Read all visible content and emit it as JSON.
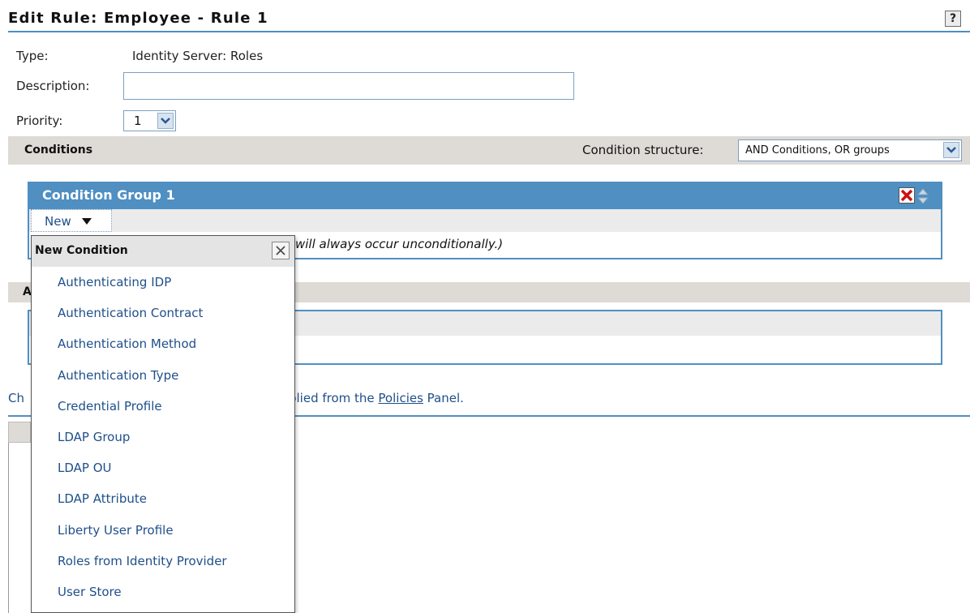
{
  "page": {
    "title": "Edit Rule: Employee - Rule 1",
    "help_label": "?"
  },
  "form": {
    "type_label": "Type:",
    "type_value": "Identity Server: Roles",
    "description_label": "Description:",
    "description_value": "",
    "priority_label": "Priority:",
    "priority_value": "1"
  },
  "conditions": {
    "section_label": "Conditions",
    "structure_label": "Condition structure:",
    "structure_value": "AND Conditions, OR groups",
    "group": {
      "title": "Condition Group 1",
      "new_label": "New",
      "message_visible": "will always occur unconditionally.)"
    }
  },
  "actions": {
    "section_label_visible": "A"
  },
  "note": {
    "prefix_visible": "Ch",
    "middle_visible": "plied from the ",
    "link": "Policies",
    "suffix": " Panel."
  },
  "dropdown": {
    "title": "New Condition",
    "items": [
      "Authenticating IDP",
      "Authentication Contract",
      "Authentication Method",
      "Authentication Type",
      "Credential Profile",
      "LDAP Group",
      "LDAP OU",
      "LDAP Attribute",
      "Liberty User Profile",
      "Roles from Identity Provider",
      "User Store"
    ]
  },
  "colors": {
    "accent_blue": "#4f8fc2",
    "section_gray": "#dedad6",
    "link_blue": "#1f4f8a",
    "delete_red": "#cc1010"
  },
  "icons": {
    "help": "question-mark-icon",
    "select_arrow": "chevron-down-icon",
    "delete": "red-x-icon",
    "reorder": "up-down-arrows-icon",
    "new_menu": "caret-down-icon",
    "close": "close-x-icon"
  }
}
